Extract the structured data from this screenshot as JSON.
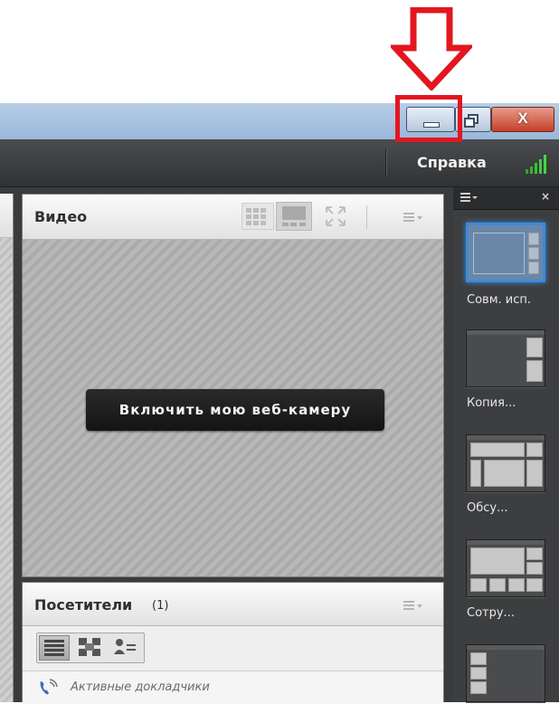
{
  "window": {
    "minimize_icon": "minimize-icon",
    "maximize_icon": "restore-icon",
    "close_label": "X",
    "accent": "#9ab7d9"
  },
  "annotation": {
    "arrow_color": "#e3161f",
    "arrow_icon": "down-arrow-icon"
  },
  "appbar": {
    "help_label": "Справка",
    "signal_icon": "signal-strength-icon"
  },
  "video_pod": {
    "title": "Видео",
    "webcam_button": "Включить мою веб-камеру",
    "icons": [
      "grid-view-icon",
      "single-view-icon",
      "fullscreen-icon",
      "pod-menu-icon"
    ]
  },
  "attendees_pod": {
    "title": "Посетители",
    "count": "(1)",
    "section_label": "Активные докладчики",
    "icons": [
      "list-view-icon",
      "breakout-view-icon",
      "attendee-status-icon",
      "phone-icon"
    ]
  },
  "layouts_panel": {
    "items": [
      {
        "label": "Совм. исп.",
        "selected": true
      },
      {
        "label": "Копия...",
        "selected": false
      },
      {
        "label": "Обсу...",
        "selected": false
      },
      {
        "label": "Сотру...",
        "selected": false
      },
      {
        "label": "",
        "selected": false
      }
    ]
  }
}
